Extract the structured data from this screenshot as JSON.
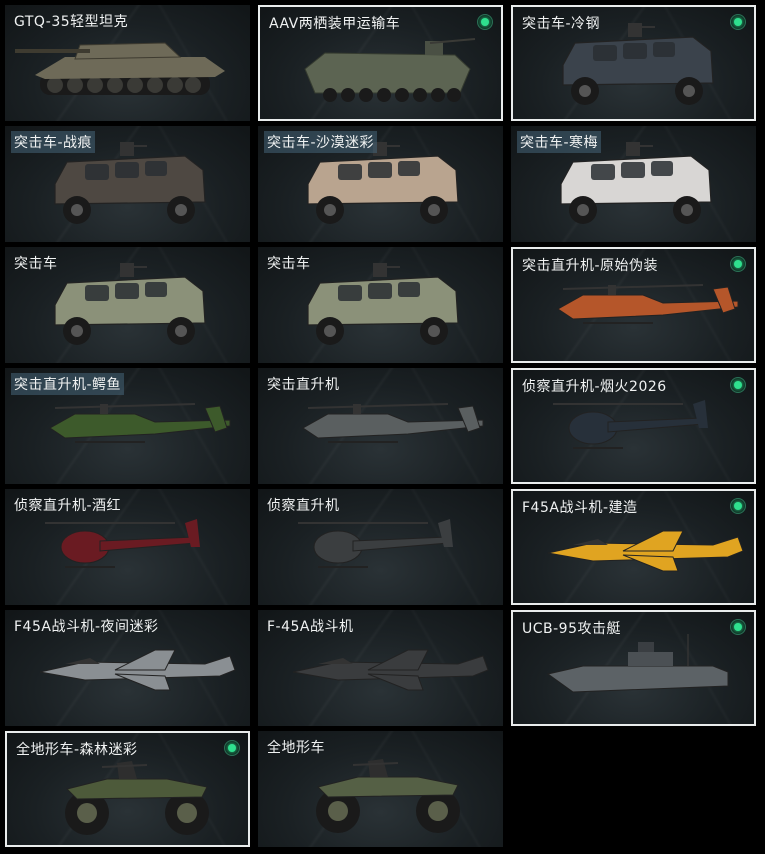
{
  "vehicles": [
    {
      "title": "GTQ-35轻型坦克",
      "selected": false,
      "active": false,
      "icon": "light-tank-icon",
      "color": "#6e6a58"
    },
    {
      "title": "AAV两栖装甲运输车",
      "selected": true,
      "active": true,
      "icon": "amphibious-apc-icon",
      "color": "#5c6452"
    },
    {
      "title": "突击车-冷钢",
      "selected": true,
      "active": true,
      "icon": "assault-vehicle-icon",
      "color": "#3b434c"
    },
    {
      "title": "突击车-战痕",
      "selected": false,
      "active": false,
      "icon": "assault-vehicle-icon",
      "color": "#4e4842"
    },
    {
      "title": "突击车-沙漠迷彩",
      "selected": false,
      "active": false,
      "icon": "assault-vehicle-icon",
      "color": "#b9a48f"
    },
    {
      "title": "突击车-寒梅",
      "selected": false,
      "active": false,
      "icon": "assault-vehicle-icon",
      "color": "#d8d6d4"
    },
    {
      "title": "突击车",
      "selected": false,
      "active": false,
      "icon": "assault-vehicle-icon",
      "color": "#8b9179"
    },
    {
      "title": "突击车",
      "selected": false,
      "active": false,
      "icon": "assault-vehicle-icon",
      "color": "#8b9179"
    },
    {
      "title": "突击直升机-原始伪装",
      "selected": true,
      "active": true,
      "icon": "attack-helicopter-icon",
      "color": "#b5562a"
    },
    {
      "title": "突击直升机-鳄鱼",
      "selected": false,
      "active": false,
      "icon": "attack-helicopter-icon",
      "color": "#3d5a2b"
    },
    {
      "title": "突击直升机",
      "selected": false,
      "active": false,
      "icon": "attack-helicopter-icon",
      "color": "#5a5f60"
    },
    {
      "title": "侦察直升机-烟火2026",
      "selected": true,
      "active": true,
      "icon": "scout-helicopter-icon",
      "color": "#27303a"
    },
    {
      "title": "侦察直升机-酒红",
      "selected": false,
      "active": false,
      "icon": "scout-helicopter-icon",
      "color": "#6a1b22"
    },
    {
      "title": "侦察直升机",
      "selected": false,
      "active": false,
      "icon": "scout-helicopter-icon",
      "color": "#3b3e40"
    },
    {
      "title": "F45A战斗机-建造",
      "selected": true,
      "active": true,
      "icon": "fighter-jet-icon",
      "color": "#e0a421"
    },
    {
      "title": "F45A战斗机-夜间迷彩",
      "selected": false,
      "active": false,
      "icon": "fighter-jet-icon",
      "color": "#8a8f93"
    },
    {
      "title": "F-45A战斗机",
      "selected": false,
      "active": false,
      "icon": "fighter-jet-icon",
      "color": "#3a3c3e"
    },
    {
      "title": "UCB-95攻击艇",
      "selected": true,
      "active": true,
      "icon": "attack-boat-icon",
      "color": "#5c6266"
    },
    {
      "title": "全地形车-森林迷彩",
      "selected": true,
      "active": true,
      "icon": "atv-icon",
      "color": "#4d5a3a"
    },
    {
      "title": "全地形车",
      "selected": false,
      "active": false,
      "icon": "atv-icon",
      "color": "#556045"
    }
  ],
  "highlight_titles": [
    3,
    4,
    5,
    9
  ]
}
